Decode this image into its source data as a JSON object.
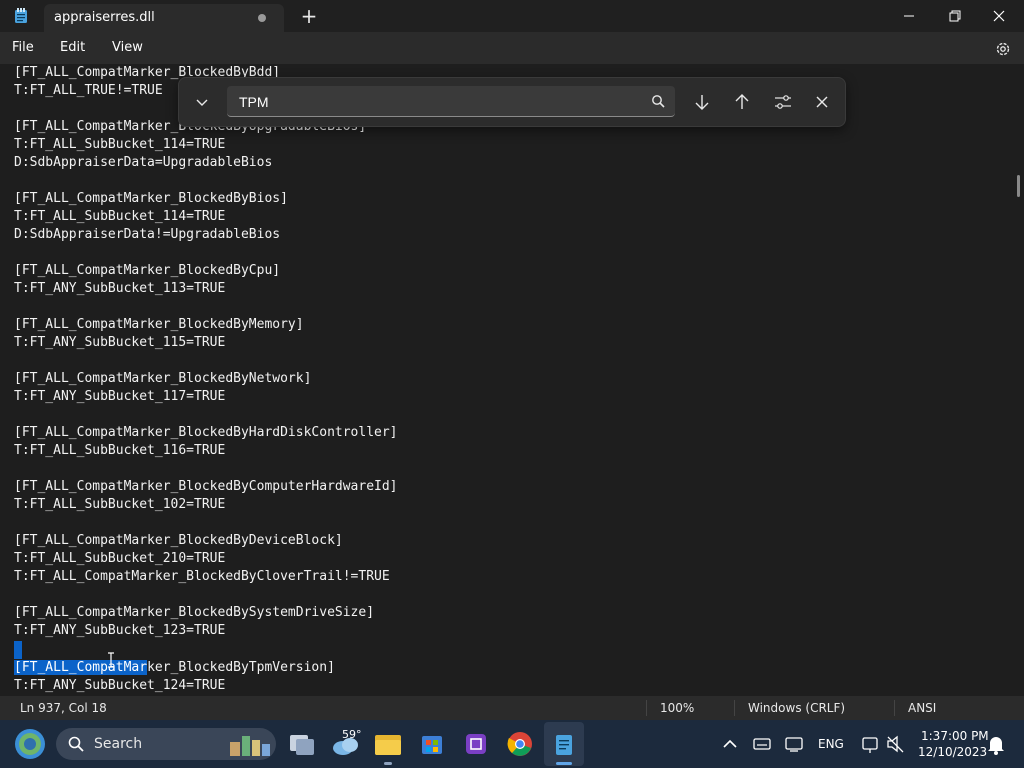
{
  "window": {
    "tab_title": "appraiserres.dll",
    "new_tab": "+"
  },
  "menu": {
    "file": "File",
    "edit": "Edit",
    "view": "View"
  },
  "find": {
    "value": "TPM",
    "placeholder": ""
  },
  "editor": {
    "lines": [
      "[FT_ALL_CompatMarker_BlockedByBdd]",
      "T:FT_ALL_TRUE!=TRUE",
      "",
      "[FT_ALL_CompatMarker_BlockedByUpgradableBios]",
      "T:FT_ALL_SubBucket_114=TRUE",
      "D:SdbAppraiserData=UpgradableBios",
      "",
      "[FT_ALL_CompatMarker_BlockedByBios]",
      "T:FT_ALL_SubBucket_114=TRUE",
      "D:SdbAppraiserData!=UpgradableBios",
      "",
      "[FT_ALL_CompatMarker_BlockedByCpu]",
      "T:FT_ANY_SubBucket_113=TRUE",
      "",
      "[FT_ALL_CompatMarker_BlockedByMemory]",
      "T:FT_ANY_SubBucket_115=TRUE",
      "",
      "[FT_ALL_CompatMarker_BlockedByNetwork]",
      "T:FT_ANY_SubBucket_117=TRUE",
      "",
      "[FT_ALL_CompatMarker_BlockedByHardDiskController]",
      "T:FT_ALL_SubBucket_116=TRUE",
      "",
      "[FT_ALL_CompatMarker_BlockedByComputerHardwareId]",
      "T:FT_ALL_SubBucket_102=TRUE",
      "",
      "[FT_ALL_CompatMarker_BlockedByDeviceBlock]",
      "T:FT_ALL_SubBucket_210=TRUE",
      "T:FT_ALL_CompatMarker_BlockedByCloverTrail!=TRUE",
      "",
      "[FT_ALL_CompatMarker_BlockedBySystemDriveSize]",
      "T:FT_ANY_SubBucket_123=TRUE",
      ""
    ],
    "selected_part": "[FT_ALL_CompatMar",
    "selected_rest": "ker_BlockedByTpmVersion]",
    "last_line": "T:FT_ANY_SubBucket_124=TRUE"
  },
  "status": {
    "position": "Ln 937, Col 18",
    "zoom": "100%",
    "line_ending": "Windows (CRLF)",
    "encoding": "ANSI"
  },
  "taskbar": {
    "search_label": "Search",
    "weather_temp": "59°",
    "language": "ENG",
    "time": "1:37:00 PM",
    "date": "12/10/2023"
  },
  "colors": {
    "selection": "#0b63c9",
    "editor_bg": "#1e1e1e",
    "taskbar_bg": "#1c2a3d"
  }
}
